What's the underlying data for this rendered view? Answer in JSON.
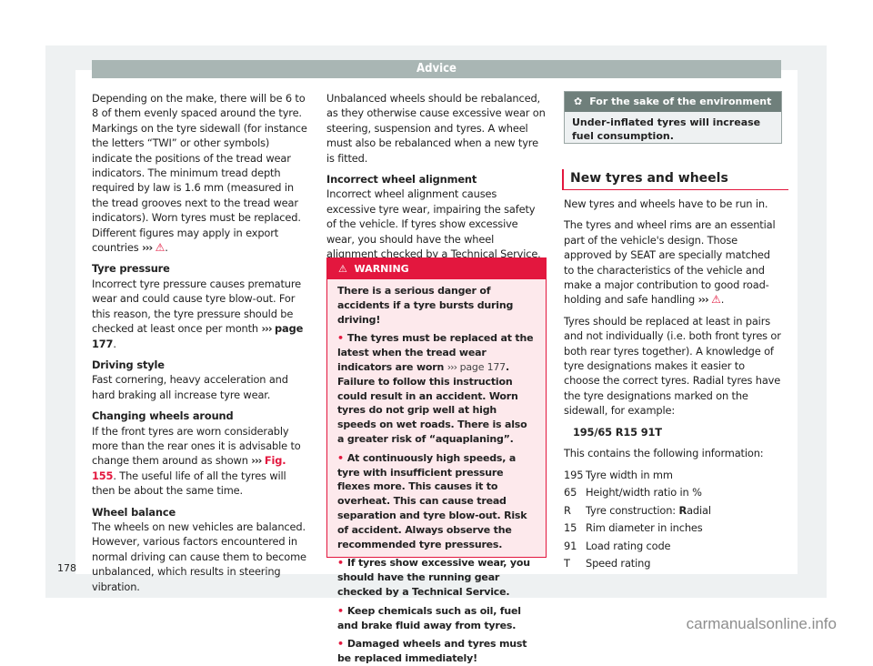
{
  "header": {
    "title": "Advice"
  },
  "page_number": "178",
  "watermark": "carmanualsonline.info",
  "accent_color": "#e3173e",
  "column1": {
    "intro": "Depending on the make, there will be 6 to 8 of them evenly spaced around the tyre. Markings on the tyre sidewall (for instance the letters “TWI” or other symbols) indicate the positions of the tread wear indicators. The minimum tread depth required by law is 1.6 mm (measured in the tread grooves next to the tread wear indicators). Worn tyres must be replaced. Different figures may apply in export countries",
    "intro_ref_arrows": "›››",
    "intro_ref_icon": "warning-triangle",
    "sections": [
      {
        "title": "Tyre pressure",
        "text": "Incorrect tyre pressure causes premature wear and could cause tyre blow-out. For this reason, the tyre pressure should be checked at least once per month",
        "ref": "page 177"
      },
      {
        "title": "Driving style",
        "text": "Fast cornering, heavy acceleration and hard braking all increase tyre wear."
      },
      {
        "title": "Changing wheels around",
        "text_before": "If the front tyres are worn considerably more than the rear ones it is advisable to change them around as shown",
        "ref": "Fig. 155",
        "text_after": ". The useful life of all the tyres will then be about the same time."
      },
      {
        "title": "Wheel balance",
        "text": "The wheels on new vehicles are balanced. However, various factors encountered in normal driving can cause them to become unbalanced, which results in steering vibration."
      }
    ]
  },
  "column2": {
    "intro": "Unbalanced wheels should be rebalanced, as they otherwise cause excessive wear on steering, suspension and tyres. A wheel must also be rebalanced when a new tyre is fitted.",
    "section": {
      "title": "Incorrect wheel alignment",
      "text": "Incorrect wheel alignment causes excessive tyre wear, impairing the safety of the vehicle. If tyres show excessive wear, you should have the wheel alignment checked by a Technical Service."
    },
    "warning": {
      "label": "WARNING",
      "icon": "warning-triangle",
      "lead": "There is a serious danger of accidents if a tyre bursts during driving!",
      "bullets": [
        {
          "before": "The tyres must be replaced at the latest when the tread wear indicators are worn",
          "ref": "page 177",
          "after": ". Failure to follow this instruction could result in an accident. Worn tyres do not grip well at high speeds on wet roads. There is also a greater risk of “aquaplaning”."
        },
        {
          "text": "At continuously high speeds, a tyre with insufficient pressure flexes more. This causes it to overheat. This can cause tread separation and tyre blow-out. Risk of accident. Always observe the recommended tyre pressures."
        },
        {
          "text": "If tyres show excessive wear, you should have the running gear checked by a Technical Service."
        },
        {
          "text": "Keep chemicals such as oil, fuel and brake fluid away from tyres."
        },
        {
          "text": "Damaged wheels and tyres must be replaced immediately!"
        }
      ]
    }
  },
  "column3": {
    "environment": {
      "icon": "flower",
      "title": "For the sake of the environment",
      "text": "Under-inflated tyres will increase fuel consumption."
    },
    "section_title": "New tyres and wheels",
    "para1": "New tyres and wheels have to be run in.",
    "para2": "The tyres and wheel rims are an essential part of the vehicle's design. Those approved by SEAT are specially matched to the characteristics of the vehicle and make a major contribution to good road-holding and safe handling",
    "para3": "Tyres should be replaced at least in pairs and not individually (i.e. both front tyres or both rear tyres together). A knowledge of tyre designations makes it easier to choose the correct tyres. Radial tyres have the tyre designations marked on the sidewall, for example:",
    "example": "195/65 R15 91T",
    "info_intro": "This contains the following information:",
    "spec": [
      {
        "code": "195",
        "desc": "Tyre width in mm"
      },
      {
        "code": "65",
        "desc": "Height/width ratio in %"
      },
      {
        "code": "R",
        "desc_bold": "R",
        "desc": "adial",
        "desc_prefix": "Tyre construction: "
      },
      {
        "code": "15",
        "desc": "Rim diameter in inches"
      },
      {
        "code": "91",
        "desc": "Load rating code"
      },
      {
        "code": "T",
        "desc": "Speed rating"
      }
    ]
  }
}
